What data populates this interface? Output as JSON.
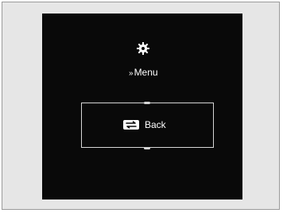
{
  "menu": {
    "prefix": "»",
    "label": "Menu",
    "icon": "gear-icon"
  },
  "selection": {
    "label": "Back",
    "icon": "back-icon"
  },
  "colors": {
    "screen_bg": "#090909",
    "text": "#ffffff",
    "outline": "#d6d6d6",
    "frame_bg": "#e6e6e6"
  }
}
